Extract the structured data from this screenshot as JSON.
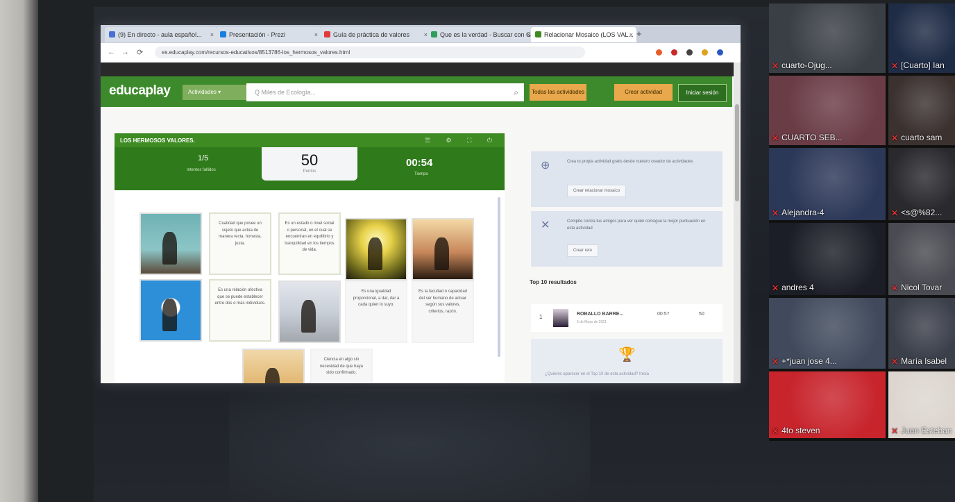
{
  "browser": {
    "tabs": [
      {
        "label": "(9) En directo - aula español...",
        "icon_color": "#4a6fd4",
        "active": false
      },
      {
        "label": "Presentación - Prezi",
        "icon_color": "#1a7de0",
        "active": false
      },
      {
        "label": "Guía de práctica de valores",
        "icon_color": "#e03a3a",
        "active": false
      },
      {
        "label": "Que es la verdad - Buscar con Google",
        "icon_color": "#2f9e5a",
        "active": false
      },
      {
        "label": "Relacionar Mosaico (LOS VAL...",
        "icon_color": "#3e8b23",
        "active": true
      }
    ],
    "url": "es.educaplay.com/recursos-educativos/8513786-los_hermosos_valores.html",
    "nav": {
      "back": "←",
      "forward": "→",
      "reload": "⟳"
    }
  },
  "site": {
    "logo": "educaplay",
    "activities_label": "Actividades ▾",
    "search_placeholder": "Q  Miles de Ecología...",
    "search_icon": "⌕",
    "buttons": {
      "all_activities": "Todas las actividades",
      "create": "Crear actividad",
      "login": "Iniciar sesión"
    }
  },
  "game": {
    "title": "LOS HERMOSOS VALORES.",
    "toolbar_icons": "☰ ⚙ ⛶ ⏻",
    "attempts": "1/5",
    "attempts_label": "Intentos fallidos",
    "score": "50",
    "score_label": "Puntos",
    "timer": "00:54",
    "timer_label": "Tiempo",
    "cards": [
      {
        "type": "img",
        "scene": "kids"
      },
      {
        "type": "text",
        "text": "Cualidad que posee un sujeto que actúa de manera recta, honesta, justa."
      },
      {
        "type": "text",
        "text": "Es un estado o nivel social o personal, en el cual se encuentran en equilibrio y tranquilidad en los tiempos de vida."
      },
      {
        "type": "img",
        "scene": "sunrise"
      },
      {
        "type": "img",
        "scene": "group"
      },
      {
        "type": "img",
        "scene": "un"
      },
      {
        "type": "text",
        "text": "Es una relación afectiva que se puede establecer entre dos o más individuos."
      },
      {
        "type": "img",
        "scene": "justice"
      },
      {
        "type": "text-plain",
        "text": "Es una igualdad proporcional, a dar, dar a cada quien lo suyo."
      },
      {
        "type": "text-plain",
        "text": "Es la facultad o capacidad del ser humano de actuar según sus valores, criterios, razón."
      },
      {
        "type": "img",
        "scene": "freedom"
      },
      {
        "type": "text-plain",
        "text": "Ciencia en algo sin necesidad de que haya sido confirmado."
      }
    ],
    "brand": "educaplay"
  },
  "sidebar": {
    "create_text": "Crea tu propia actividad gratis desde nuestro creador de actividades",
    "create_button": "Crear relacionar mosaico",
    "challenge_text": "Compite contra tus amigos para ver quién consigue la mejor puntuación en esta actividad",
    "challenge_button": "Crear reto",
    "top10_title": "Top 10 resultados",
    "result": {
      "rank": "1",
      "name": "ROBALLO BARRE...",
      "date": "5 de Mayo de 2021",
      "score": "00:57",
      "points": "50"
    },
    "trophy_text": "¿Quieres aparecer en el Top 10 de esta actividad? Inicia"
  },
  "video_call": {
    "tiles": [
      {
        "name": "cuarto-Ojug...",
        "bg": "#3a3f46"
      },
      {
        "name": "[Cuarto] Ian",
        "bg": "#1f2c46"
      },
      {
        "name": "CUARTO SEB...",
        "bg": "#6a3c46"
      },
      {
        "name": "cuarto sam",
        "bg": "#3b3230"
      },
      {
        "name": "Alejandra-4",
        "bg": "#2c3858"
      },
      {
        "name": "<s@%82...",
        "bg": "#2a2a2e"
      },
      {
        "name": "andres 4",
        "bg": "#1b1e26"
      },
      {
        "name": "Nicol Tovar",
        "bg": "#4a4a52"
      },
      {
        "name": "+*juan jose 4...",
        "bg": "#404a5c"
      },
      {
        "name": "María Isabel",
        "bg": "#3b3f4a"
      },
      {
        "name": "4to steven",
        "bg": "#c8242c"
      },
      {
        "name": "Juan Esteban",
        "bg": "#ddd6d0"
      }
    ]
  }
}
